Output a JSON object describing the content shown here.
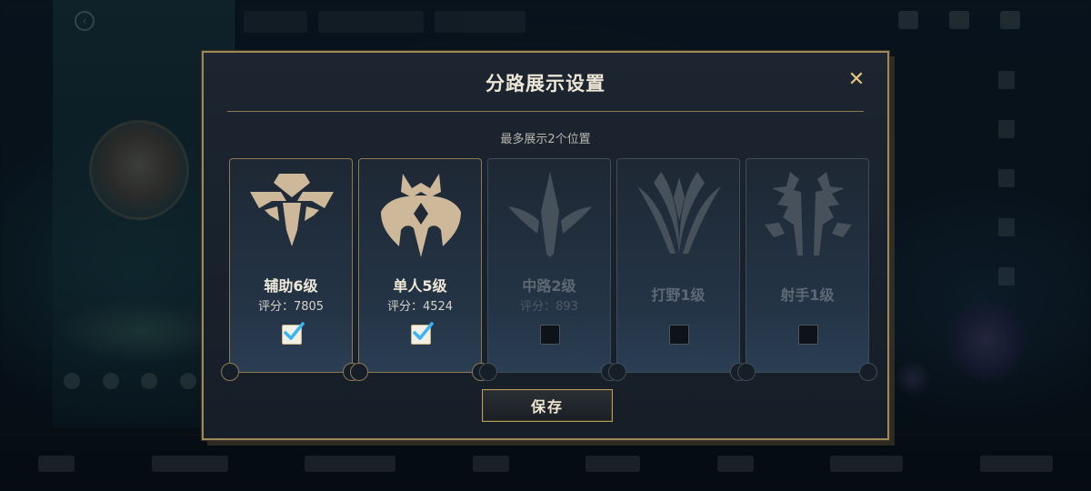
{
  "dialog": {
    "title": "分路展示设置",
    "close_glyph": "✕",
    "subtitle": "最多展示2个位置",
    "save_label": "保存"
  },
  "roles": [
    {
      "key": "support",
      "icon": "support-role-icon",
      "rank": "辅助6级",
      "score": "评分：7805",
      "checked": true,
      "dimmed": false
    },
    {
      "key": "solo",
      "icon": "solo-role-icon",
      "rank": "单人5级",
      "score": "评分：4524",
      "checked": true,
      "dimmed": false
    },
    {
      "key": "mid",
      "icon": "mid-role-icon",
      "rank": "中路2级",
      "score": "评分：893",
      "checked": false,
      "dimmed": true
    },
    {
      "key": "jungle",
      "icon": "jungle-role-icon",
      "rank": "打野1级",
      "score": "",
      "checked": false,
      "dimmed": true
    },
    {
      "key": "adc",
      "icon": "marksman-role-icon",
      "rank": "射手1级",
      "score": "",
      "checked": false,
      "dimmed": true
    }
  ],
  "colors": {
    "accent_gold": "#9c8858",
    "active_icon": "#cdb89a",
    "inactive_icon": "#47515b",
    "check_blue": "#3ab4f2"
  }
}
